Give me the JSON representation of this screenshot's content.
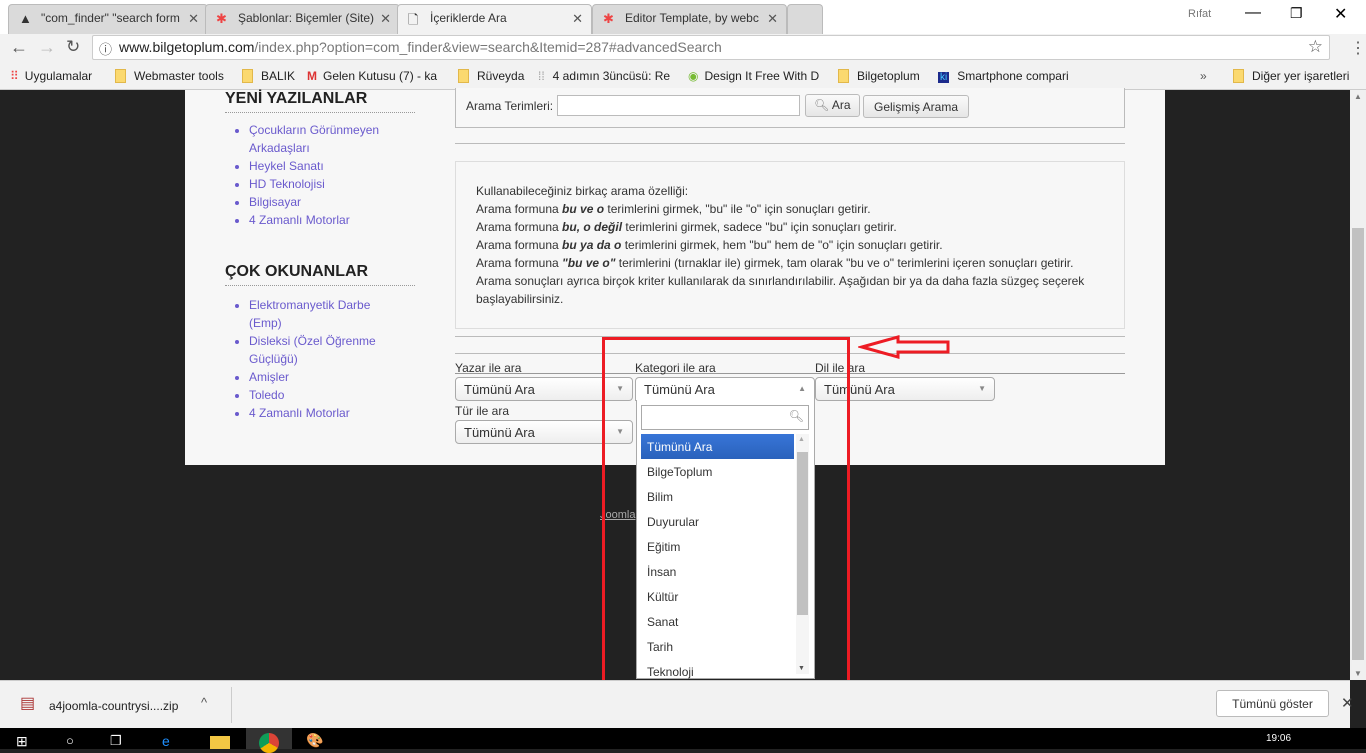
{
  "browser": {
    "tabs": [
      {
        "title": "\"com_finder\" \"search form",
        "icon": "logo-icon"
      },
      {
        "title": "Şablonlar: Biçemler (Site)",
        "icon": "joomla-icon"
      },
      {
        "title": "İçeriklerde Ara",
        "icon": "page-icon"
      },
      {
        "title": "Editor Template, by webc",
        "icon": "joomla-icon"
      }
    ],
    "profile": "Rıfat",
    "url_host": "www.bilgetoplum.com",
    "url_path": "/index.php?option=com_finder&view=search&Itemid=287#advancedSearch",
    "bookmarks": [
      "Uygulamalar",
      "Webmaster tools",
      "BALIK",
      "Gelen Kutusu (7) - ka",
      "Rüveyda",
      "4 adımın 3üncüsü: Re",
      "Design It Free With D",
      "Bilgetoplum",
      "Smartphone compari"
    ],
    "other_bookmarks": "Diğer yer işaretleri"
  },
  "sidebar": {
    "recent_title": "YENİ YAZILANLAR",
    "recent": [
      "Çocukların Görünmeyen Arkadaşları",
      "Heykel Sanatı",
      "HD Teknolojisi",
      "Bilgisayar",
      "4 Zamanlı Motorlar"
    ],
    "popular_title": "ÇOK OKUNANLAR",
    "popular": [
      "Elektromanyetik Darbe (Emp)",
      "Disleksi (Özel Öğrenme Güçlüğü)",
      "Amişler",
      "Toledo",
      "4 Zamanlı Motorlar"
    ]
  },
  "search": {
    "label": "Arama Terimleri:",
    "value": "",
    "button": "Ara",
    "advanced": "Gelişmiş Arama"
  },
  "help": [
    {
      "pre": "Kullanabileceğiniz birkaç arama özelliği:",
      "em": "",
      "post": ""
    },
    {
      "pre": "Arama formuna ",
      "em": "bu ve o",
      "post": " terimlerini girmek, \"bu\" ile \"o\" için sonuçları getirir."
    },
    {
      "pre": "Arama formuna ",
      "em": "bu, o değil",
      "post": " terimlerini girmek, sadece \"bu\" için sonuçları getirir."
    },
    {
      "pre": "Arama formuna ",
      "em": "bu ya da o",
      "post": " terimlerini girmek, hem \"bu\" hem de \"o\" için sonuçları getirir."
    },
    {
      "pre": "Arama formuna ",
      "em": "\"bu ve o\"",
      "post": " terimlerini (tırnaklar ile) girmek, tam olarak \"bu ve o\" terimlerini içeren sonuçları getirir."
    },
    {
      "pre": "Arama sonuçları ayrıca birçok kriter kullanılarak da sınırlandırılabilir. Aşağıdan bir ya da daha fazla süzgeç seçerek başlayabilirsiniz.",
      "em": "",
      "post": ""
    }
  ],
  "filters": {
    "author": {
      "label": "Yazar ile ara",
      "value": "Tümünü Ara"
    },
    "category": {
      "label": "Kategori ile ara",
      "value": "Tümünü Ara",
      "search": "",
      "options": [
        "Tümünü Ara",
        "BilgeToplum",
        "Bilim",
        "Duyurular",
        "Eğitim",
        "İnsan",
        "Kültür",
        "Sanat",
        "Tarih",
        "Teknoloji"
      ]
    },
    "language": {
      "label": "Dil ile ara",
      "value": "Tümünü Ara"
    },
    "type": {
      "label": "Tür ile ara",
      "value": "Tümünü Ara"
    }
  },
  "footer": {
    "link": "Joomla"
  },
  "download": {
    "file": "a4joomla-countrysi....zip",
    "show_all": "Tümünü göster"
  },
  "taskbar": {
    "time": "19:06"
  },
  "colors": {
    "annotation": "#ed1c24",
    "highlight": "#3875d7",
    "link": "#6a5acd"
  }
}
